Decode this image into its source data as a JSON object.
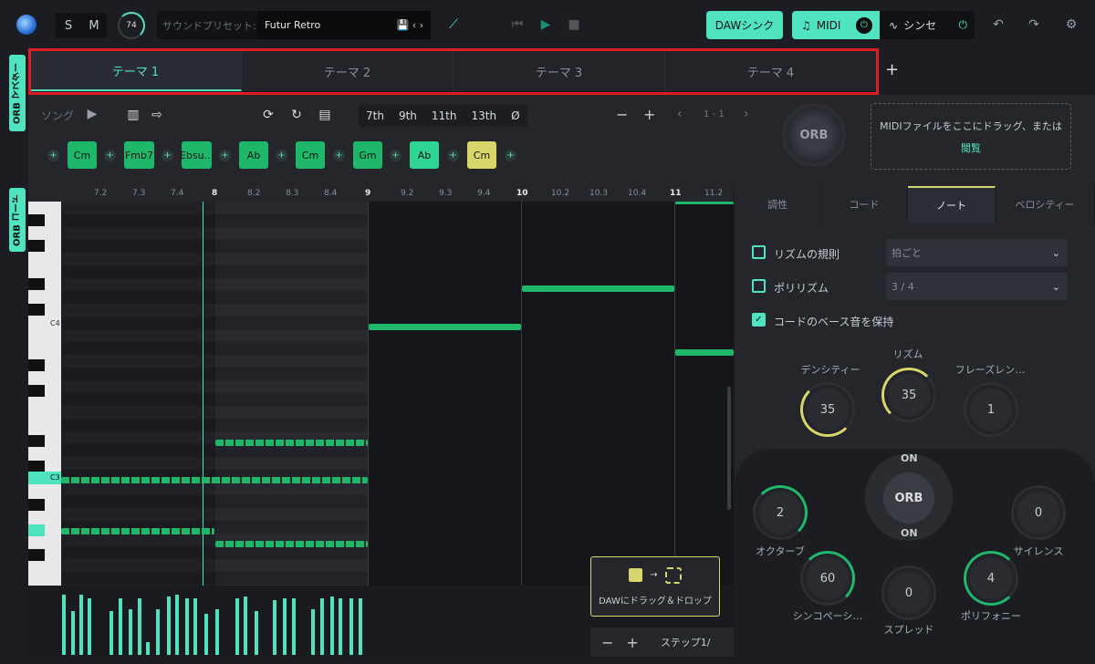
{
  "topbar": {
    "s": "S",
    "m": "M",
    "knob_value": "74",
    "preset_label": "サウンドプリセット:",
    "preset_value": "Futur Retro",
    "daw_sync": "DAWシンク",
    "midi": "MIDI",
    "synth": "シンセ"
  },
  "side": {
    "master": "ORB マスター",
    "chord": "ORB コード"
  },
  "tabs": [
    "テーマ 1",
    "テーマ 2",
    "テーマ 3",
    "テーマ 4"
  ],
  "add_tab": "+",
  "song": {
    "label": "ソング",
    "extensions": [
      "7th",
      "9th",
      "11th",
      "13th",
      "Ø"
    ],
    "range": "1 - 1",
    "minus": "−",
    "plus": "+"
  },
  "chords": [
    "Cm",
    "Fmb7",
    "Ebsu...",
    "Ab",
    "Cm",
    "Gm",
    "Ab",
    "Cm"
  ],
  "orb": "ORB",
  "midi_drop": {
    "text": "MIDIファイルをここにドラッグ、または",
    "link": "閲覧"
  },
  "ruler": [
    "7.2",
    "7.3",
    "7.4",
    "8",
    "8.2",
    "8.3",
    "8.4",
    "9",
    "9.2",
    "9.3",
    "9.4",
    "10",
    "10.2",
    "10.3",
    "10.4",
    "11",
    "11.2"
  ],
  "piano": {
    "c4": "C4",
    "c3": "C3"
  },
  "rtabs": [
    "調性",
    "コード",
    "ノート",
    "ベロシティー"
  ],
  "options": {
    "rhythm_rule": "リズムの規則",
    "rhythm_rule_val": "拍ごと",
    "polyrhythm": "ポリリズム",
    "polyrhythm_val": "3 / 4",
    "keep_bass": "コードのベース音を保持"
  },
  "knobs": {
    "density_label": "デンシティー",
    "density": "35",
    "rhythm_label": "リズム",
    "rhythm": "35",
    "phrase_label": "フレーズレン…",
    "phrase": "1",
    "octave_label": "オクターブ",
    "octave": "2",
    "silence_label": "サイレンス",
    "silence": "0",
    "syncopation_label": "シンコペーシ…",
    "syncopation": "60",
    "spread_label": "スプレッド",
    "spread": "0",
    "polyphony_label": "ポリフォニー",
    "polyphony": "4"
  },
  "orb_center": {
    "label": "ORB",
    "on_top": "ON",
    "on_bottom": "ON"
  },
  "drag": {
    "arrow": "→",
    "text": "DAWにドラッグ＆ドロップ"
  },
  "step": {
    "minus": "−",
    "plus": "+",
    "label": "ステップ1/"
  },
  "colors": {
    "accent": "#4fe3c0",
    "note": "#1fb86a",
    "chord_active": "#d8d66a",
    "highlight": "#e01b24"
  }
}
